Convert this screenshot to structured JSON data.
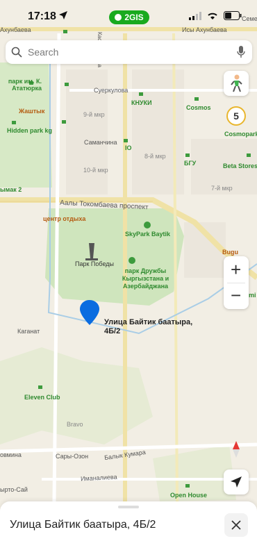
{
  "status_bar": {
    "time": "17:18",
    "app_badge": "2GIS"
  },
  "search": {
    "placeholder": "Search"
  },
  "map": {
    "streets": {
      "top_left": "Ахунбаева",
      "top_right": "Исы Ахунбаева",
      "top_far_right": "Семе",
      "suerkulova": "Суеркулова",
      "samanchina": "Саманчина",
      "aaly": "Аалы Токомбаева проспект",
      "kasymaliev": "Касымалиева",
      "balyk": "Балык Кумара",
      "imanalieva": "Иманалиева",
      "kaganat": "Каганат",
      "sary": "Сары-Озон",
      "bravo": "Bravo",
      "ovmina": "овмина",
      "yrto": "ырто-Сай",
      "ymak": "ымак 2"
    },
    "districts": {
      "d9": "9-й мкр",
      "d10": "10-й мкр",
      "d8": "8-й мкр",
      "d7": "7-й мкр"
    },
    "pois": {
      "park_ataturk": "парк им. К. Ататюрка",
      "zhashtyk": "Жаштык",
      "hidden_park": "Hidden park kg",
      "knuki": "КНУКИ",
      "cosmos": "Cosmos",
      "cosmopark": "Cosmopark",
      "io": "IO",
      "bgu": "БГУ",
      "beta": "Beta Stores",
      "center_rest": "центр отдыха",
      "skypark": "SkyPark Baytik",
      "park_pobedy": "Парк Победы",
      "park_druzhby": "парк Дружбы Кыргызстана и Азербайджана",
      "bugu": "Bugu",
      "mi": "mi",
      "eleven": "Eleven Club",
      "open_house": "Open House"
    },
    "pin": {
      "line1": "Улица Байтик баатыра,",
      "line2": "4Б/2"
    }
  },
  "controls": {
    "traffic_score": "5",
    "zoom_in": "+",
    "zoom_out": "−"
  },
  "bottom_sheet": {
    "address": "Улица Байтик баатыра, 4Б/2"
  },
  "colors": {
    "green": "#19aa1e",
    "pin": "#0a6ce0",
    "park": "#d4e8c4",
    "road": "#ece1b4"
  }
}
